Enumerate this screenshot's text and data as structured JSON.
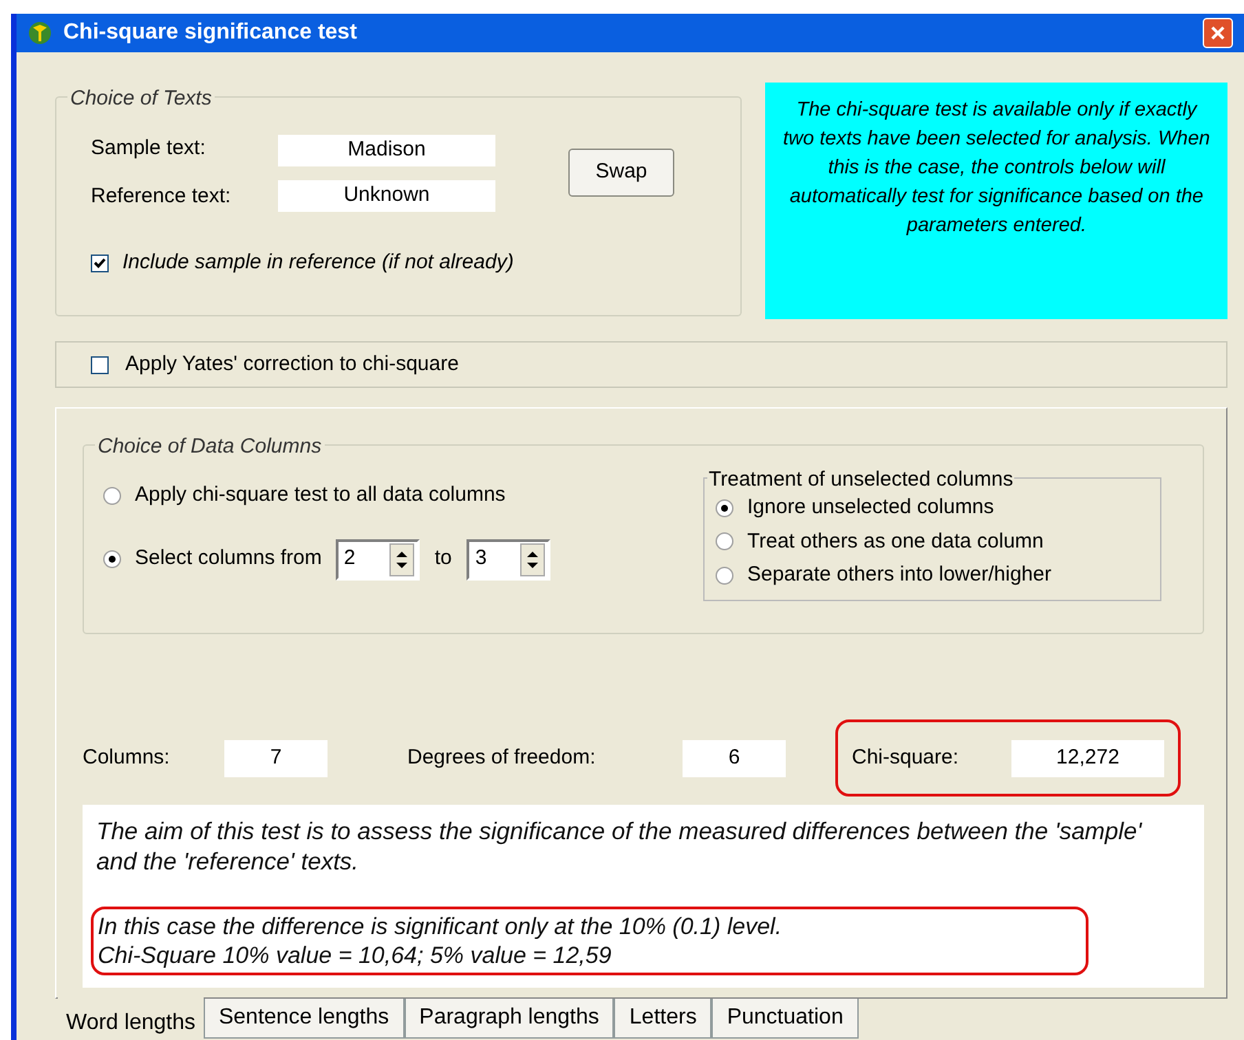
{
  "window": {
    "title": "Chi-square significance test"
  },
  "choice_of_texts": {
    "title": "Choice of Texts",
    "sample_label": "Sample text:",
    "sample_value": "Madison",
    "reference_label": "Reference text:",
    "reference_value": "Unknown",
    "swap_button": "Swap",
    "include_sample": {
      "label": "Include sample in reference (if not already)",
      "checked": true
    }
  },
  "info_note": "The chi-square test is available only if exactly two texts have been selected for analysis.  When this is the case, the controls below will automatically test for significance based on the parameters entered.",
  "yates": {
    "label": "Apply Yates' correction to chi-square",
    "checked": false
  },
  "data_columns": {
    "title": "Choice of Data Columns",
    "options": [
      {
        "kind": "plain",
        "label": "Apply chi-square test to all data columns",
        "selected": false
      },
      {
        "kind": "range",
        "label": "Select columns from",
        "from": "2",
        "to_label": "to",
        "to": "3",
        "selected": true
      }
    ]
  },
  "treatment": {
    "title": "Treatment of unselected columns",
    "options": [
      {
        "label": "Ignore unselected columns",
        "selected": true
      },
      {
        "label": "Treat others as one data column",
        "selected": false
      },
      {
        "label": "Separate others into lower/higher",
        "selected": false
      }
    ]
  },
  "stats": [
    {
      "label": "Columns:",
      "value": "7",
      "highlighted": false
    },
    {
      "label": "Degrees of freedom:",
      "value": "6",
      "highlighted": false
    },
    {
      "label": "Chi-square:",
      "value": "12,272",
      "highlighted": true
    }
  ],
  "description": "The aim of this test is to assess the significance of the measured differences between the 'sample' and the 'reference' texts.",
  "result": {
    "lines": [
      "In this case the difference is significant only at the 10% (0.1) level.",
      "Chi-Square 10% value = 10,64;  5% value = 12,59"
    ],
    "highlighted": true
  },
  "tabs": [
    {
      "label": "Word lengths",
      "selected": true
    },
    {
      "label": "Sentence lengths",
      "selected": false
    },
    {
      "label": "Paragraph lengths",
      "selected": false
    },
    {
      "label": "Letters",
      "selected": false
    },
    {
      "label": "Punctuation",
      "selected": false
    }
  ]
}
